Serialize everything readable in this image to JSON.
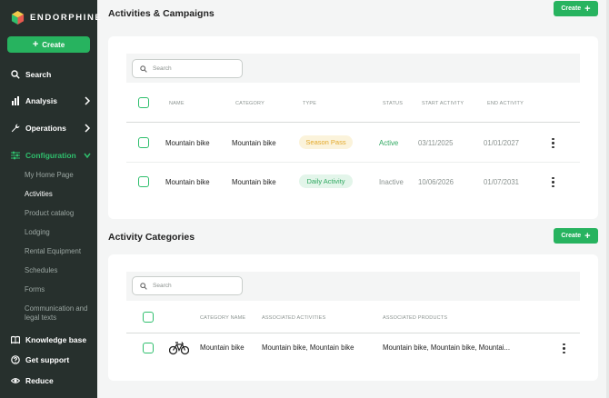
{
  "brand": {
    "name": "ENDORPHINE"
  },
  "sidebar": {
    "create_label": "Create",
    "items": [
      {
        "label": "Search",
        "icon": "search-icon"
      },
      {
        "label": "Analysis",
        "icon": "bar-chart-icon"
      },
      {
        "label": "Operations",
        "icon": "wrench-icon"
      },
      {
        "label": "Configuration",
        "icon": "sliders-icon"
      }
    ],
    "config_sub": [
      "My Home Page",
      "Activities",
      "Product catalog",
      "Lodging",
      "Rental Equipment",
      "Schedules",
      "Forms",
      "Communication and legal texts"
    ],
    "bottom": [
      {
        "label": "Knowledge base",
        "icon": "book-icon"
      },
      {
        "label": "Get support",
        "icon": "help-icon"
      },
      {
        "label": "Reduce",
        "icon": "eye-icon"
      }
    ]
  },
  "activities": {
    "title": "Activities & Campaigns",
    "create_label": "Create",
    "search_placeholder": "Search",
    "columns": [
      "NAME",
      "CATEGORY",
      "TYPE",
      "STATUS",
      "START ACTIVITY",
      "END ACTIVITY"
    ],
    "rows": [
      {
        "name": "Mountain bike",
        "category": "Mountain bike",
        "type": "Season Pass",
        "status": "Active",
        "start": "03/11/2025",
        "end": "01/01/2027"
      },
      {
        "name": "Mountain bike",
        "category": "Mountain bike",
        "type": "Daily Activity",
        "status": "Inactive",
        "start": "10/06/2026",
        "end": "01/07/2031"
      }
    ]
  },
  "categories": {
    "title": "Activity Categories",
    "create_label": "Create",
    "search_placeholder": "Search",
    "columns": [
      "CATEGORY NAME",
      "ASSOCIATED ACTIVITIES",
      "ASSOCIATED PRODUCTS"
    ],
    "rows": [
      {
        "name": "Mountain bike",
        "activities": "Mountain bike, Mountain bike",
        "products": "Mountain bike, Mountain bike, Mountai..."
      }
    ]
  },
  "colors": {
    "accent": "#27b35f",
    "sidebar_bg": "#27302d",
    "active_nav": "#2fbf6d",
    "season_badge": "#e3a82a"
  }
}
